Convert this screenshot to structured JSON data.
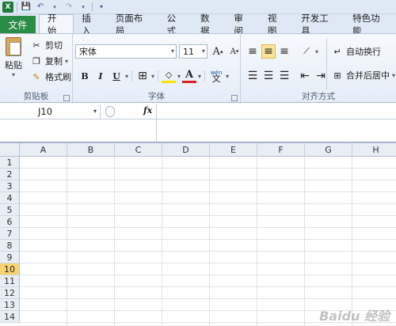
{
  "qat": {
    "save_icon": "save-icon",
    "undo_icon": "undo-icon",
    "redo_icon": "redo-icon"
  },
  "tabs": {
    "file": "文件",
    "items": [
      "开始",
      "插入",
      "页面布局",
      "公式",
      "数据",
      "审阅",
      "视图",
      "开发工具",
      "特色功能"
    ]
  },
  "ribbon": {
    "clipboard": {
      "paste": "粘贴",
      "cut": "剪切",
      "copy": "复制",
      "painter": "格式刷",
      "label": "剪贴板"
    },
    "font": {
      "name": "宋体",
      "size": "11",
      "label": "字体",
      "bold": "B",
      "italic": "I",
      "underline": "U",
      "grow": "A",
      "shrink": "A",
      "color_a": "A",
      "wen": "文",
      "wen_top": "wén"
    },
    "align": {
      "wrap": "自动换行",
      "merge": "合并后居中",
      "label": "对齐方式"
    }
  },
  "formula": {
    "namebox": "J10",
    "fx": "fx"
  },
  "grid": {
    "columns": [
      "A",
      "B",
      "C",
      "D",
      "E",
      "F",
      "G",
      "H"
    ],
    "rows": [
      "1",
      "2",
      "3",
      "4",
      "5",
      "6",
      "7",
      "8",
      "9",
      "10",
      "11",
      "12",
      "13",
      "14"
    ],
    "selected_row": "10"
  },
  "watermark": "Baidu 经验"
}
